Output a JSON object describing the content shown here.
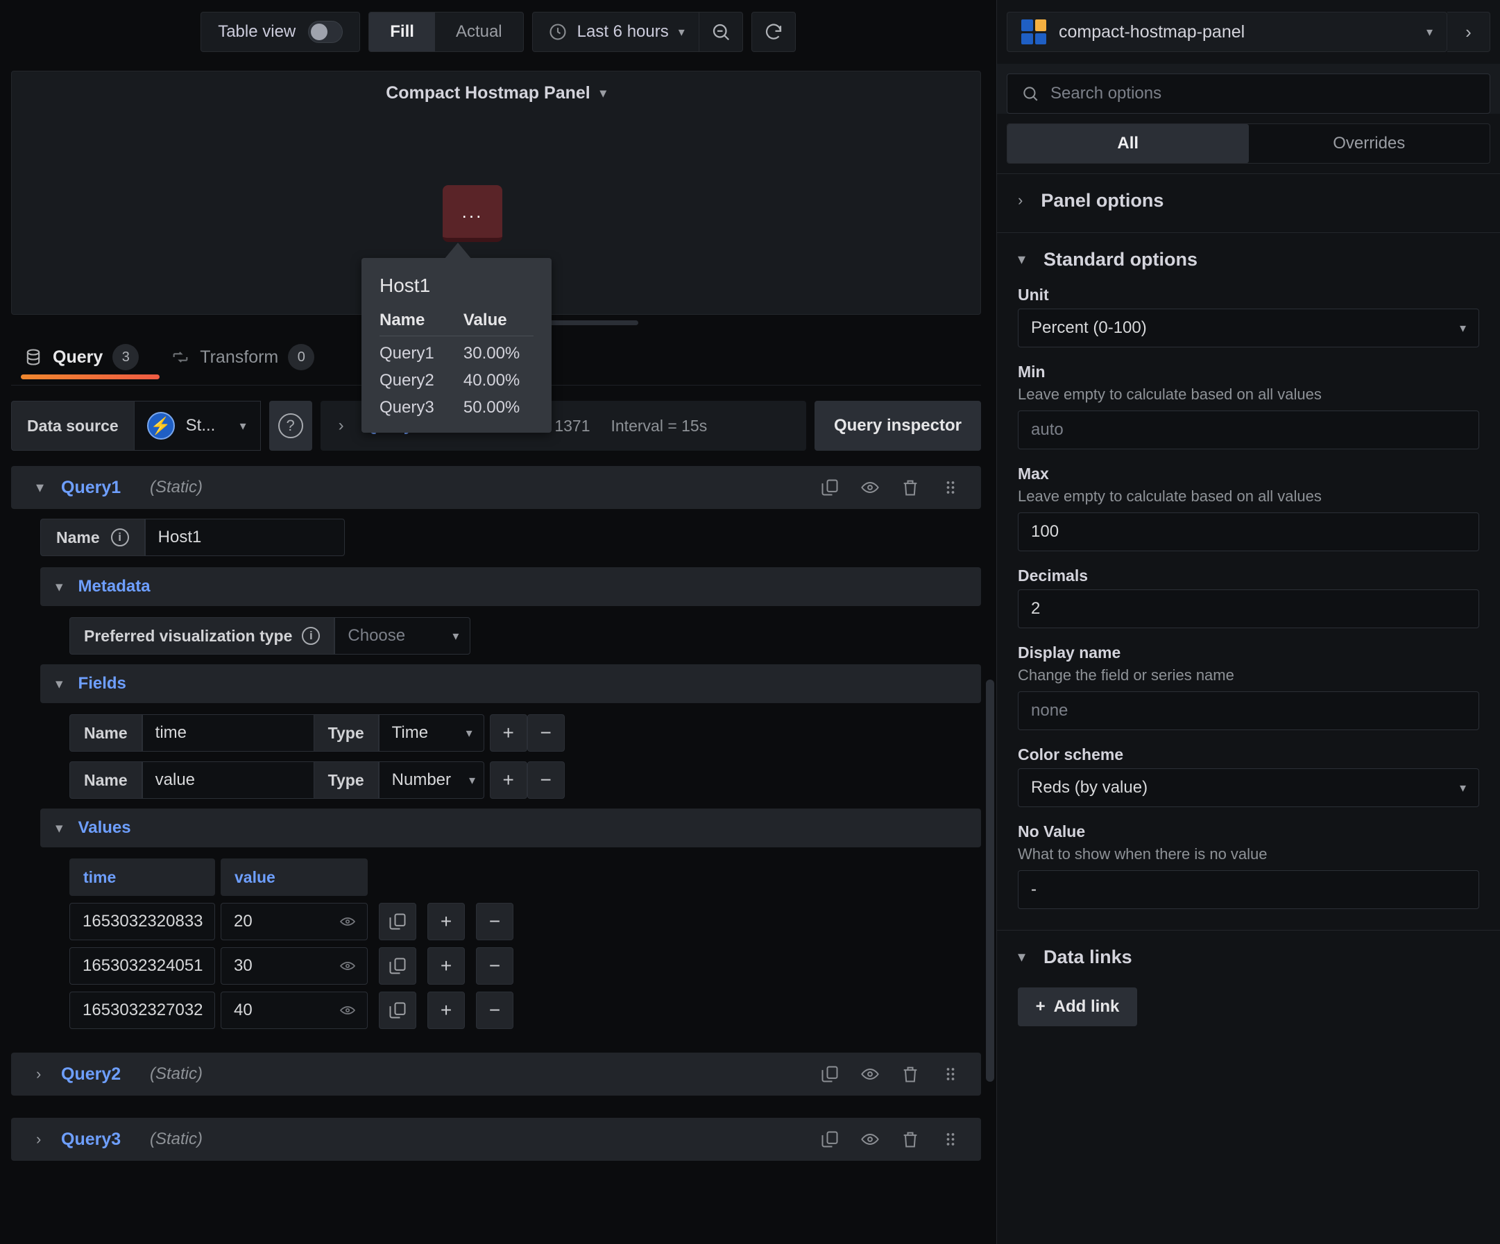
{
  "toolbar": {
    "table_view_label": "Table view",
    "table_view_on": false,
    "fill_label": "Fill",
    "actual_label": "Actual",
    "time_range": "Last 6 hours",
    "clock_icon": "clock-icon",
    "zoom_out_icon": "zoom-out-icon",
    "refresh_icon": "refresh-icon"
  },
  "preview": {
    "panel_title": "Compact Hostmap Panel",
    "cell_label": "...",
    "cell_color": "#5a2428"
  },
  "tooltip": {
    "host": "Host1",
    "col_name": "Name",
    "col_value": "Value",
    "rows": [
      {
        "name": "Query1",
        "value": "30.00%"
      },
      {
        "name": "Query2",
        "value": "40.00%"
      },
      {
        "name": "Query3",
        "value": "50.00%"
      }
    ]
  },
  "tabs": [
    {
      "label": "Query",
      "badge": "3",
      "icon": "database-icon",
      "active": true
    },
    {
      "label": "Transform",
      "badge": "0",
      "icon": "transform-icon",
      "active": false
    }
  ],
  "query_options": {
    "data_source_label": "Data source",
    "data_source_name": "St...",
    "data_source_icon": "lightning-icon",
    "help_icon": "help-circle-icon",
    "options_label": "Query o...",
    "max_data_points": "MD = auto = 1371",
    "interval": "Interval = 15s",
    "query_inspector": "Query inspector"
  },
  "queries": [
    {
      "name": "Query1",
      "type": "(Static)",
      "expanded": true,
      "name_field": {
        "label": "Name",
        "value": "Host1"
      },
      "metadata": {
        "title": "Metadata",
        "pref_viz_label": "Preferred visualization type",
        "pref_viz_value": "Choose"
      },
      "fields": {
        "title": "Fields",
        "name_label": "Name",
        "type_label": "Type",
        "rows": [
          {
            "name": "time",
            "type": "Time"
          },
          {
            "name": "value",
            "type": "Number"
          }
        ]
      },
      "values": {
        "title": "Values",
        "columns": [
          "time",
          "value"
        ],
        "rows": [
          {
            "time": "1653032320833",
            "value": "20"
          },
          {
            "time": "1653032324051",
            "value": "30"
          },
          {
            "time": "1653032327032",
            "value": "40"
          }
        ]
      }
    },
    {
      "name": "Query2",
      "type": "(Static)",
      "expanded": false
    },
    {
      "name": "Query3",
      "type": "(Static)",
      "expanded": false
    }
  ],
  "row_icons": [
    "copy-icon",
    "eye-icon",
    "trash-icon",
    "drag-handle-icon"
  ],
  "sidebar": {
    "viz_name": "compact-hostmap-panel",
    "search_placeholder": "Search options",
    "tab_all": "All",
    "tab_overrides": "Overrides",
    "sections": [
      {
        "title": "Panel options",
        "expanded": false
      },
      {
        "title": "Standard options",
        "expanded": true
      },
      {
        "title": "Data links",
        "expanded": true
      }
    ],
    "standard_options": {
      "unit": {
        "label": "Unit",
        "value": "Percent (0-100)"
      },
      "min": {
        "label": "Min",
        "desc": "Leave empty to calculate based on all values",
        "placeholder": "auto",
        "value": ""
      },
      "max": {
        "label": "Max",
        "desc": "Leave empty to calculate based on all values",
        "value": "100"
      },
      "decimals": {
        "label": "Decimals",
        "value": "2"
      },
      "display_name": {
        "label": "Display name",
        "desc": "Change the field or series name",
        "placeholder": "none",
        "value": ""
      },
      "color_scheme": {
        "label": "Color scheme",
        "value": "Reds (by value)"
      },
      "no_value": {
        "label": "No Value",
        "desc": "What to show when there is no value",
        "value": "-"
      }
    },
    "data_links": {
      "add_link_label": "Add link"
    }
  }
}
